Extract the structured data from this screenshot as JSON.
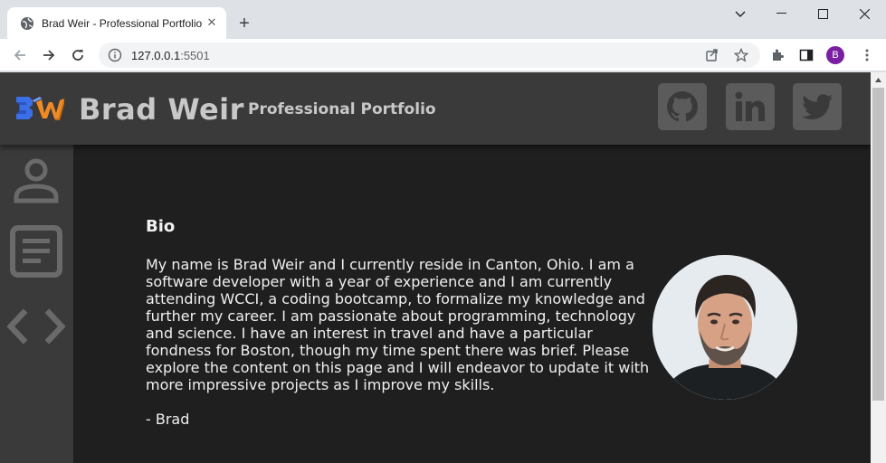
{
  "browser": {
    "tab_title": "Brad Weir - Professional Portfolio",
    "url_host": "127.0.0.1",
    "url_port": ":5501",
    "profile_initial": "B"
  },
  "site": {
    "name": "Brad Weir",
    "tagline": "Professional Portfolio",
    "social": [
      "github-icon",
      "linkedin-icon",
      "twitter-icon"
    ],
    "sidebar": [
      "profile-icon",
      "document-icon",
      "code-icon"
    ]
  },
  "bio": {
    "heading": "Bio",
    "text": "My name is Brad Weir and I currently reside in Canton, Ohio. I am a software developer with a year of experience and I am currently attending WCCI, a coding bootcamp, to formalize my knowledge and further my career. I am passionate about programming, technology and science. I have an interest in travel and have a particular fondness for Boston, though my time spent there was brief. Please explore the content on this page and I will endeavor to update it with more impressive projects as I improve my skills.",
    "signature": "- Brad"
  },
  "colors": {
    "header_bg": "#3a3a3a",
    "page_bg": "#1f1f1f",
    "text": "#f0f0f0",
    "accent_blue": "#3a6fe8",
    "accent_orange": "#f08a24"
  }
}
